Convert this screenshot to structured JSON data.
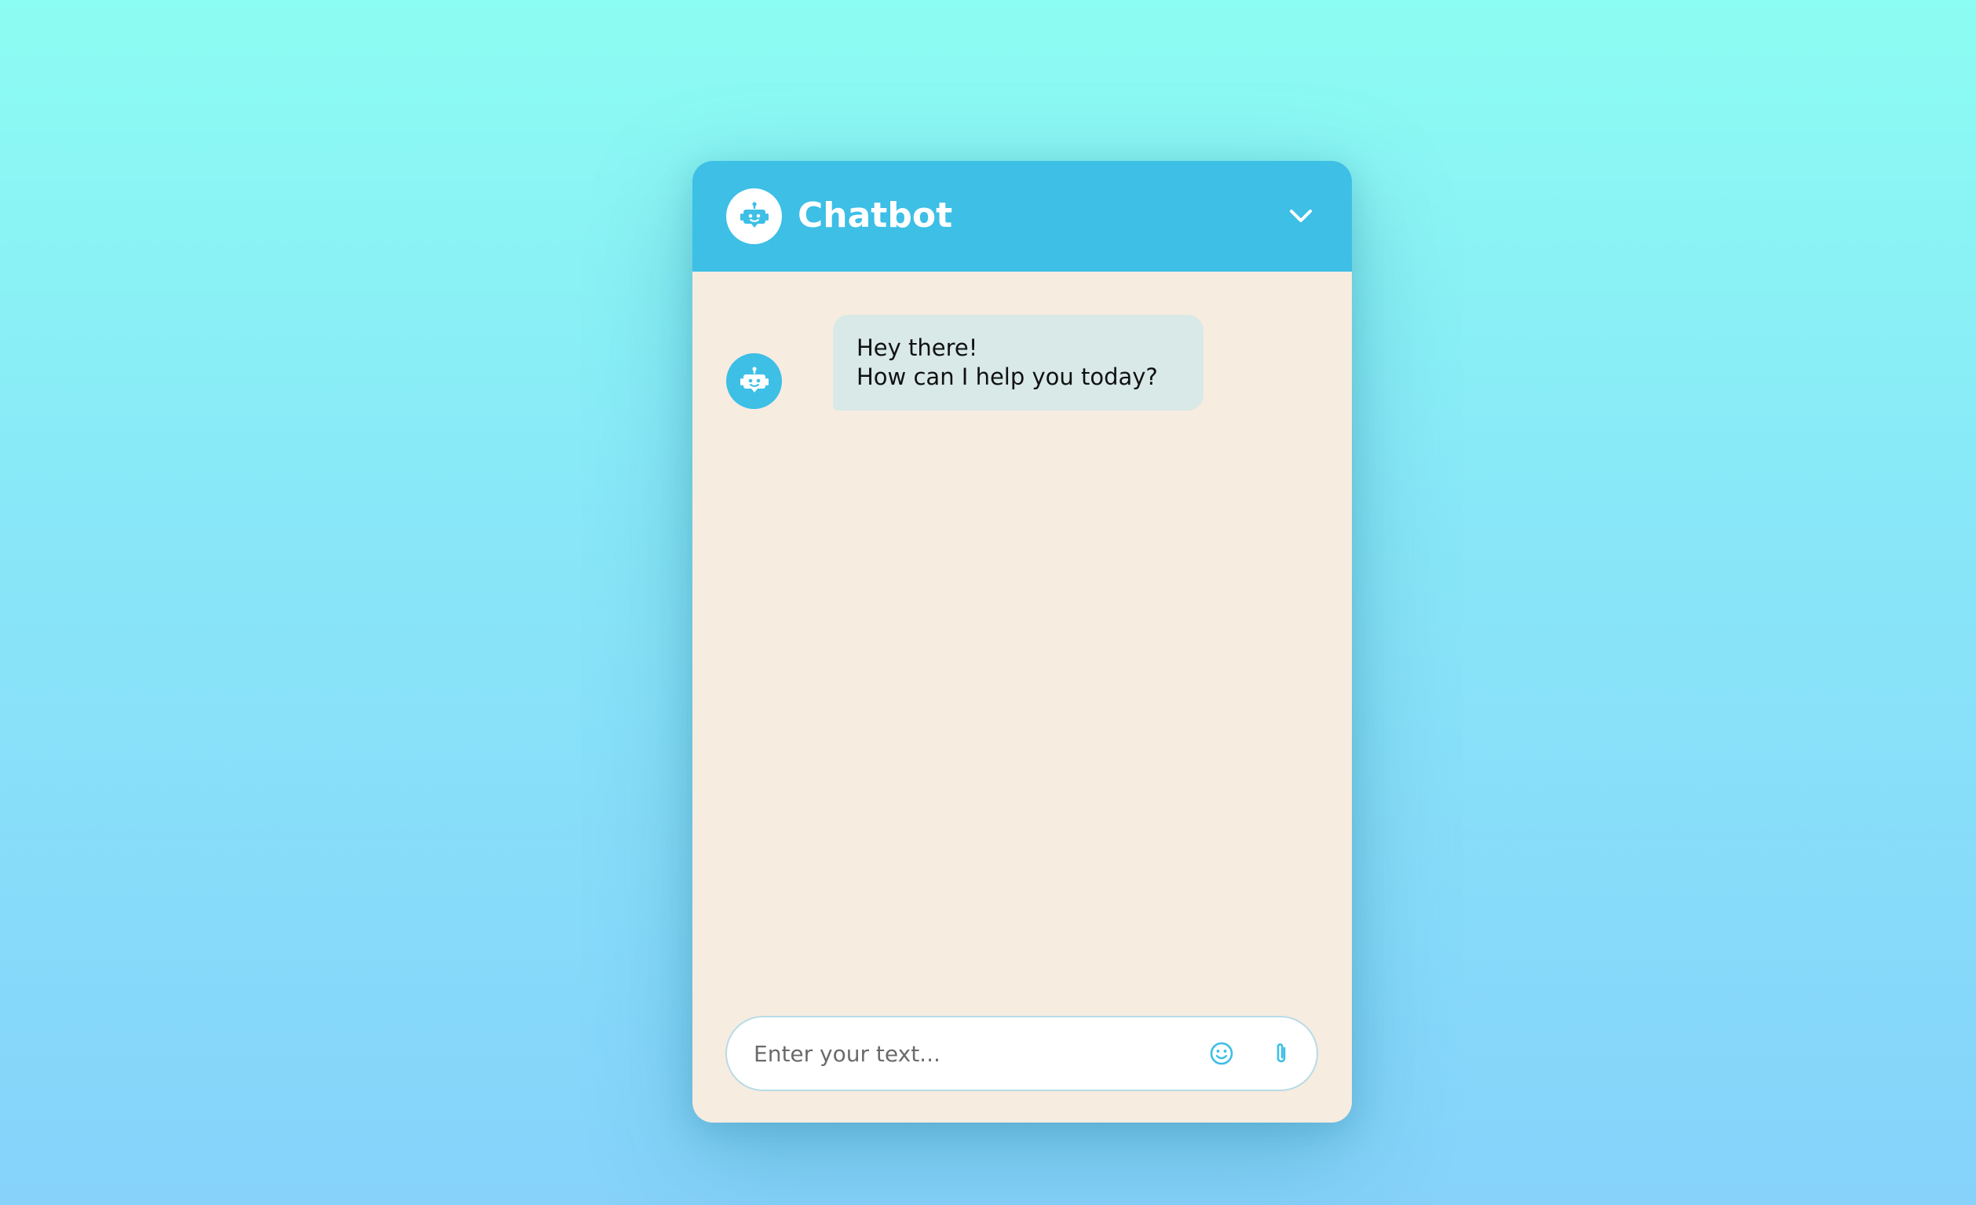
{
  "header": {
    "title": "Chatbot",
    "avatar_icon": "robot-icon",
    "collapse_icon": "chevron-down-icon"
  },
  "messages": [
    {
      "sender": "bot",
      "avatar_icon": "robot-icon",
      "lines": [
        "Hey there!",
        "How can I help you today?"
      ]
    }
  ],
  "input": {
    "placeholder": "Enter your text...",
    "value": "",
    "emoji_icon": "smiley-icon",
    "attach_icon": "paperclip-icon"
  },
  "colors": {
    "accent": "#3dbfe6",
    "chat_background": "#f7ece0",
    "bot_bubble": "#d8e9e7",
    "page_gradient_top": "#8cfdf2",
    "page_gradient_bottom": "#86d2fb"
  }
}
